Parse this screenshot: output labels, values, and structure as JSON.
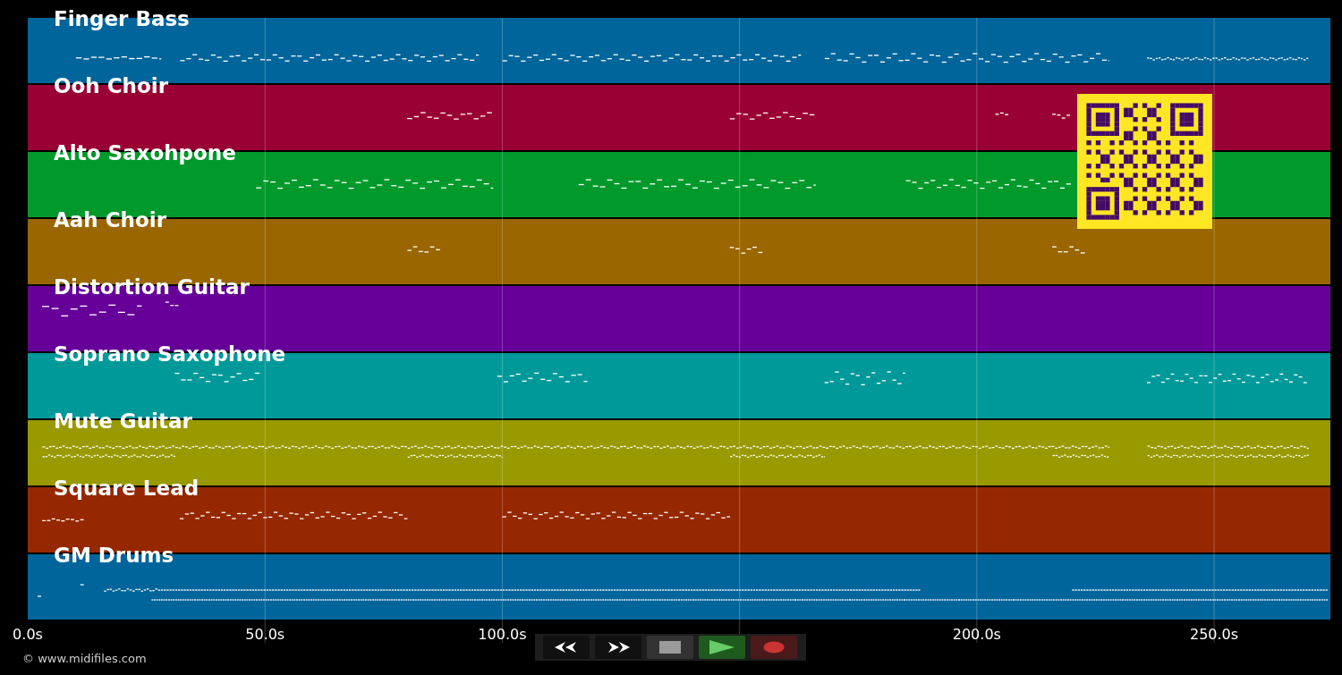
{
  "tracks": [
    {
      "name": "Finger Bass",
      "color": "#00659a"
    },
    {
      "name": "Ooh Choir",
      "color": "#990033"
    },
    {
      "name": "Alto Saxohpone",
      "color": "#00992b"
    },
    {
      "name": "Aah Choir",
      "color": "#996600"
    },
    {
      "name": "Distortion Guitar",
      "color": "#660099"
    },
    {
      "name": "Soprano Saxophone",
      "color": "#009999"
    },
    {
      "name": "Mute Guitar",
      "color": "#999900"
    },
    {
      "name": "Square Lead",
      "color": "#952800"
    },
    {
      "name": "GM Drums",
      "color": "#00659a"
    }
  ],
  "time_axis": {
    "ticks": [
      "0.0s",
      "50.0s",
      "100.0s",
      "200.0s",
      "250.0s"
    ]
  },
  "transport": [
    {
      "kind": "rewind"
    },
    {
      "kind": "forward"
    },
    {
      "kind": "stop"
    },
    {
      "kind": "play"
    },
    {
      "kind": "record"
    }
  ],
  "copyright": "© www.midifiles.com"
}
